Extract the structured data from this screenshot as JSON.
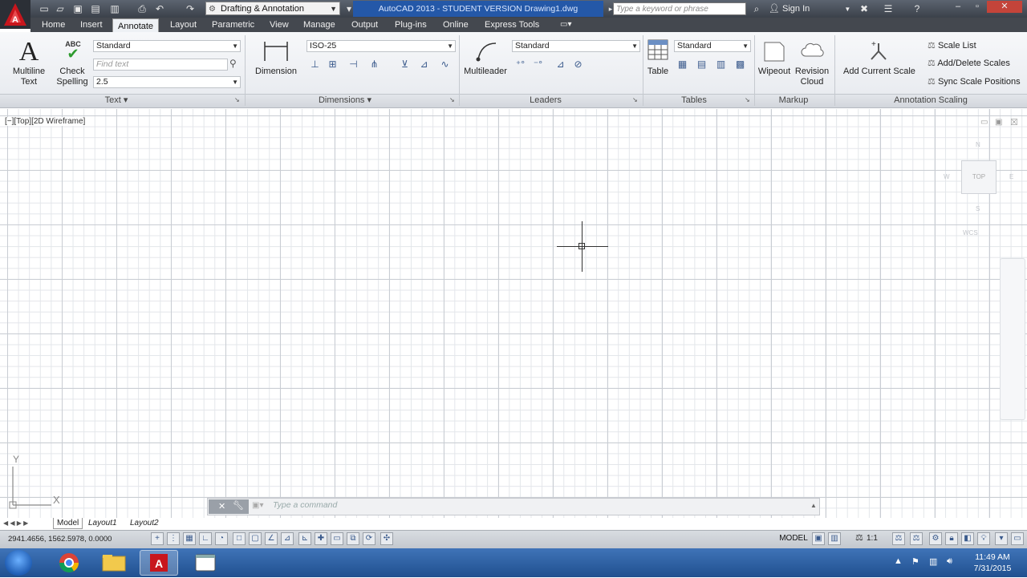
{
  "titlebar": {
    "workspace": "Drafting & Annotation",
    "title": "AutoCAD 2013 - STUDENT VERSION   Drawing1.dwg",
    "search_placeholder": "Type a keyword or phrase",
    "signin": "Sign In"
  },
  "tabs": [
    "Home",
    "Insert",
    "Annotate",
    "Layout",
    "Parametric",
    "View",
    "Manage",
    "Output",
    "Plug-ins",
    "Online",
    "Express Tools"
  ],
  "active_tab": "Annotate",
  "ribbon": {
    "text_panel": {
      "title": "Text",
      "multiline_label": "Multiline Text",
      "check_spelling_label": "Check Spelling",
      "abc_glyph": "ABC",
      "style_value": "Standard",
      "find_placeholder": "Find text",
      "height_value": "2.5"
    },
    "dimensions_panel": {
      "title": "Dimensions",
      "dimension_label": "Dimension",
      "style_value": "ISO-25"
    },
    "leaders_panel": {
      "title": "Leaders",
      "multileader_label": "Multileader",
      "style_value": "Standard"
    },
    "tables_panel": {
      "title": "Tables",
      "table_label": "Table",
      "style_value": "Standard"
    },
    "markup_panel": {
      "title": "Markup",
      "wipeout_label": "Wipeout",
      "revision_cloud_label": "Revision Cloud"
    },
    "scaling_panel": {
      "title": "Annotation Scaling",
      "add_current_scale_label": "Add Current Scale",
      "scale_list_label": "Scale List",
      "add_delete_scales_label": "Add/Delete Scales",
      "sync_scale_positions_label": "Sync Scale Positions"
    }
  },
  "viewport": {
    "label": "[−][Top][2D Wireframe]",
    "viewcube_face": "TOP",
    "viewcube_n": "N",
    "viewcube_w": "W",
    "viewcube_e": "E",
    "viewcube_s": "S",
    "wcs": "WCS",
    "ucs_y": "Y",
    "ucs_x": "X"
  },
  "commandline": {
    "placeholder": "Type a command"
  },
  "layout_tabs": [
    "Model",
    "Layout1",
    "Layout2"
  ],
  "statusbar": {
    "coordinates": "2941.4656, 1562.5978, 0.0000",
    "model": "MODEL",
    "scale": "1:1"
  },
  "taskbar": {
    "time": "11:49 AM",
    "date": "7/31/2015"
  },
  "colors": {
    "accent": "#2458a8",
    "autocad_red": "#c8161d",
    "taskbar": "#2a5e9e"
  }
}
